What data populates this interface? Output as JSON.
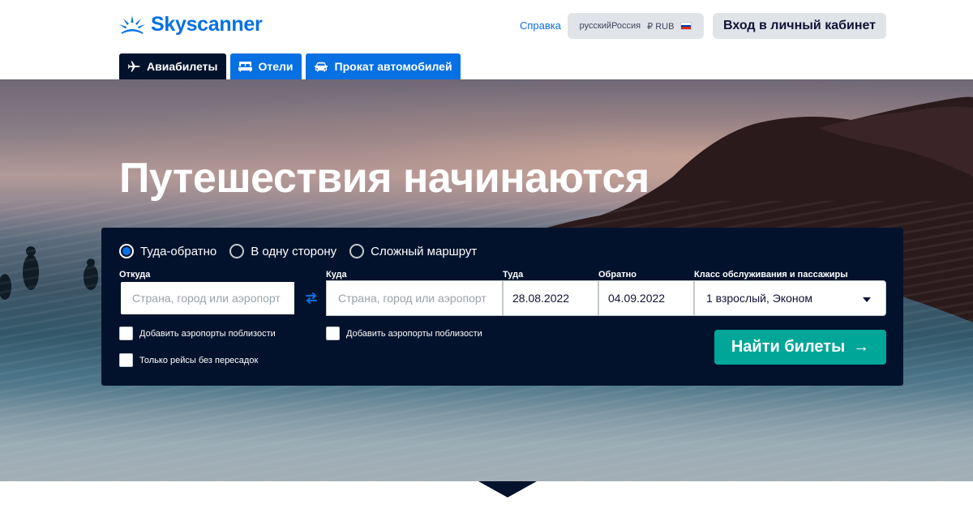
{
  "header": {
    "logo_text": "Skyscanner",
    "help_label": "Справка",
    "locale": {
      "language": "русский",
      "country": "Россия",
      "currency": "₽ RUB"
    },
    "login_label": "Вход в личный кабинет"
  },
  "tabs": [
    {
      "label": "Авиабилеты",
      "icon": "plane-icon",
      "active": true
    },
    {
      "label": "Отели",
      "icon": "bed-icon",
      "active": false
    },
    {
      "label": "Прокат автомобилей",
      "icon": "car-icon",
      "active": false
    }
  ],
  "hero": {
    "title": "Путешествия начинаются"
  },
  "search": {
    "trip_types": [
      {
        "label": "Туда-обратно",
        "checked": true
      },
      {
        "label": "В одну сторону",
        "checked": false
      },
      {
        "label": "Сложный маршрут",
        "checked": false
      }
    ],
    "from": {
      "label": "Откуда",
      "placeholder": "Страна, город или аэропорт",
      "value": ""
    },
    "to": {
      "label": "Куда",
      "placeholder": "Страна, город или аэропорт",
      "value": ""
    },
    "depart": {
      "label": "Туда",
      "value": "28.08.2022"
    },
    "return": {
      "label": "Обратно",
      "value": "04.09.2022"
    },
    "cabin": {
      "label": "Класс обслуживания и пассажиры",
      "value": "1 взрослый, Эконом"
    },
    "nearby_from_label": "Добавить аэропорты поблизости",
    "nearby_to_label": "Добавить аэропорты поблизости",
    "direct_only_label": "Только рейсы без пересадок",
    "submit_label": "Найти билеты",
    "submit_arrow": "→"
  },
  "colors": {
    "brand_blue": "#0770e3",
    "panel_navy": "#02122c",
    "cta_teal": "#00a698",
    "button_gray": "#e0e4e9"
  }
}
